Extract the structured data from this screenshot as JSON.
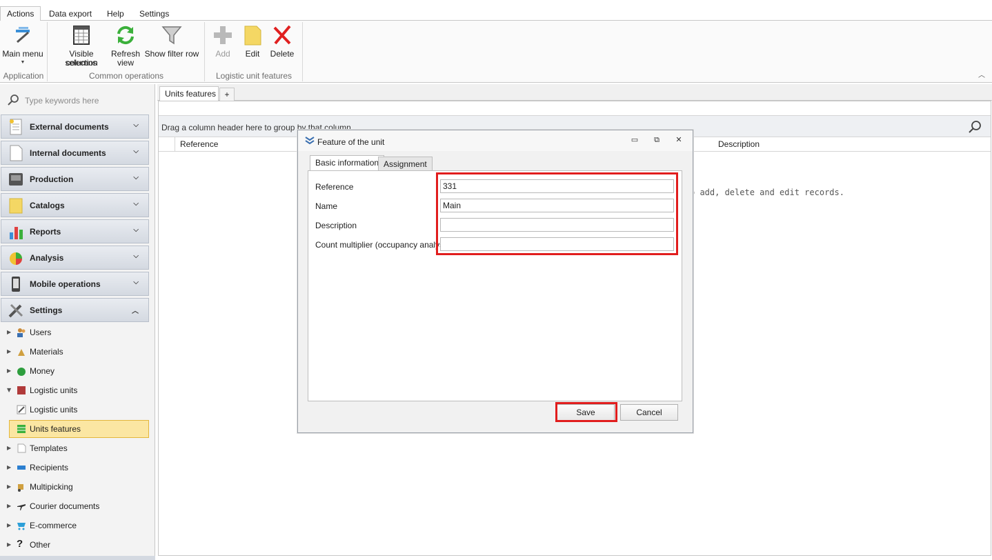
{
  "menu": {
    "tabs": [
      "Actions",
      "Data export",
      "Help",
      "Settings"
    ]
  },
  "ribbon": {
    "main_menu": "Main menu",
    "visible_columns_1": "Visible columns",
    "visible_columns_2": "selection",
    "refresh_1": "Refresh",
    "refresh_2": "view",
    "show_filter": "Show filter row",
    "add": "Add",
    "edit": "Edit",
    "delete": "Delete",
    "groups": [
      "Application",
      "Common operations",
      "Logistic unit features"
    ]
  },
  "sidebar": {
    "search_placeholder": "Type keywords here",
    "sections": [
      "External documents",
      "Internal documents",
      "Production",
      "Catalogs",
      "Reports",
      "Analysis",
      "Mobile operations",
      "Settings"
    ],
    "settings_items": [
      "Users",
      "Materials",
      "Money",
      "Logistic units",
      "Logistic units",
      "Units features",
      "Templates",
      "Recipients",
      "Multipicking",
      "Courier documents",
      "E-commerce",
      "Other"
    ]
  },
  "main": {
    "tab": "Units features",
    "plus": "+",
    "group_hint": "Drag a column header here to group by that column",
    "columns": [
      "Reference",
      "Description"
    ],
    "empty_hint": "o add, delete and edit records."
  },
  "dialog": {
    "title": "Feature of the unit",
    "tabs": [
      "Basic information",
      "Assignment"
    ],
    "fields": [
      {
        "label": "Reference",
        "value": "331"
      },
      {
        "label": "Name",
        "value": "Main"
      },
      {
        "label": "Description",
        "value": ""
      },
      {
        "label": "Count multiplier (occupancy analysis)",
        "value": ""
      }
    ],
    "save": "Save",
    "cancel": "Cancel"
  }
}
